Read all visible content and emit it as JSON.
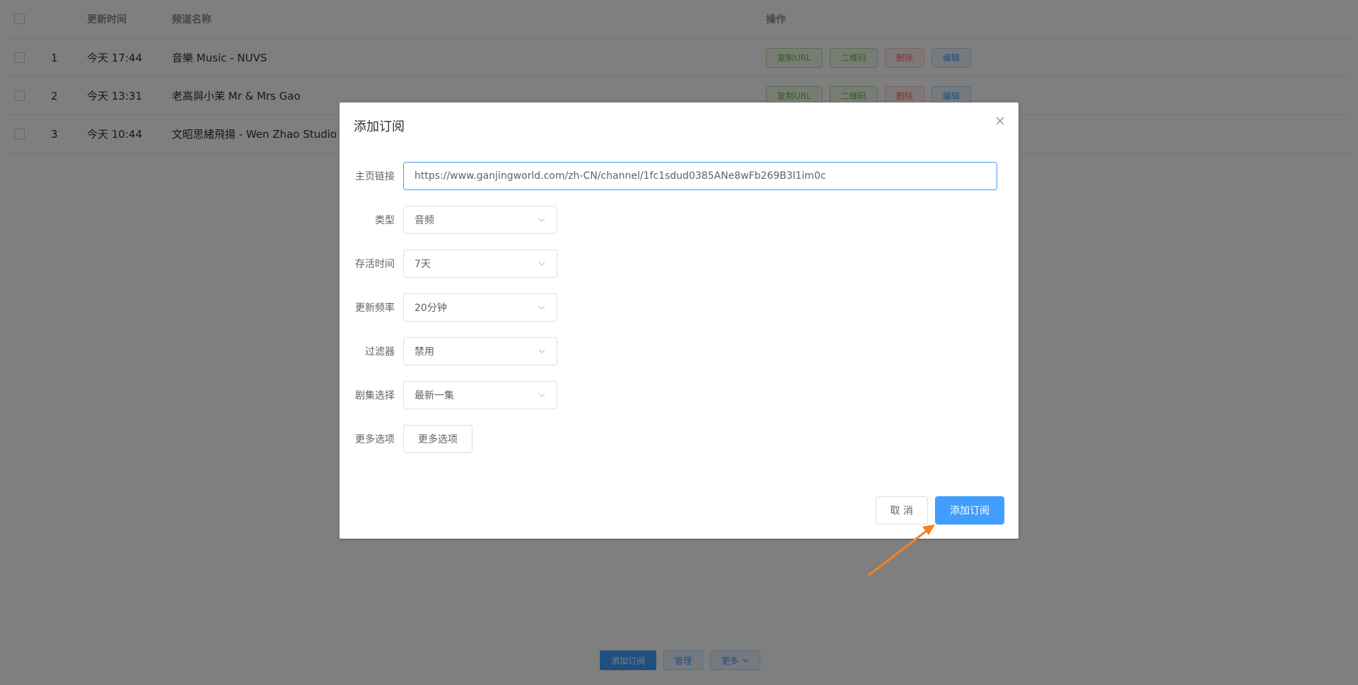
{
  "table": {
    "headers": {
      "time": "更新时间",
      "name": "频道名称",
      "ops": "操作"
    },
    "rows": [
      {
        "index": "1",
        "time": "今天 17:44",
        "name": "音樂 Music - NUVS"
      },
      {
        "index": "2",
        "time": "今天 13:31",
        "name": "老高與小茉 Mr & Mrs Gao"
      },
      {
        "index": "3",
        "time": "今天 10:44",
        "name": "文昭思緒飛揚 - Wen Zhao Studio"
      }
    ],
    "row_actions": {
      "copy_url": "复制URL",
      "qrcode": "二维码",
      "delete": "删除",
      "edit": "编辑"
    }
  },
  "bottom_bar": {
    "add": "添加订阅",
    "manage": "管理",
    "more": "更多"
  },
  "dialog": {
    "title": "添加订阅",
    "fields": {
      "homepage": {
        "label": "主页链接",
        "value": "https://www.ganjingworld.com/zh-CN/channel/1fc1sdud0385ANe8wFb269B3l1im0c"
      },
      "type": {
        "label": "类型",
        "value": "音频"
      },
      "keep_time": {
        "label": "存活时间",
        "value": "7天"
      },
      "update_freq": {
        "label": "更新频率",
        "value": "20分钟"
      },
      "filter": {
        "label": "过滤器",
        "value": "禁用"
      },
      "episode": {
        "label": "剧集选择",
        "value": "最新一集"
      },
      "more_options": {
        "label": "更多选项",
        "button": "更多选项"
      }
    },
    "cancel": "取 消",
    "confirm": "添加订阅"
  },
  "colors": {
    "primary": "#409eff",
    "annotation_arrow": "#f5821f"
  }
}
